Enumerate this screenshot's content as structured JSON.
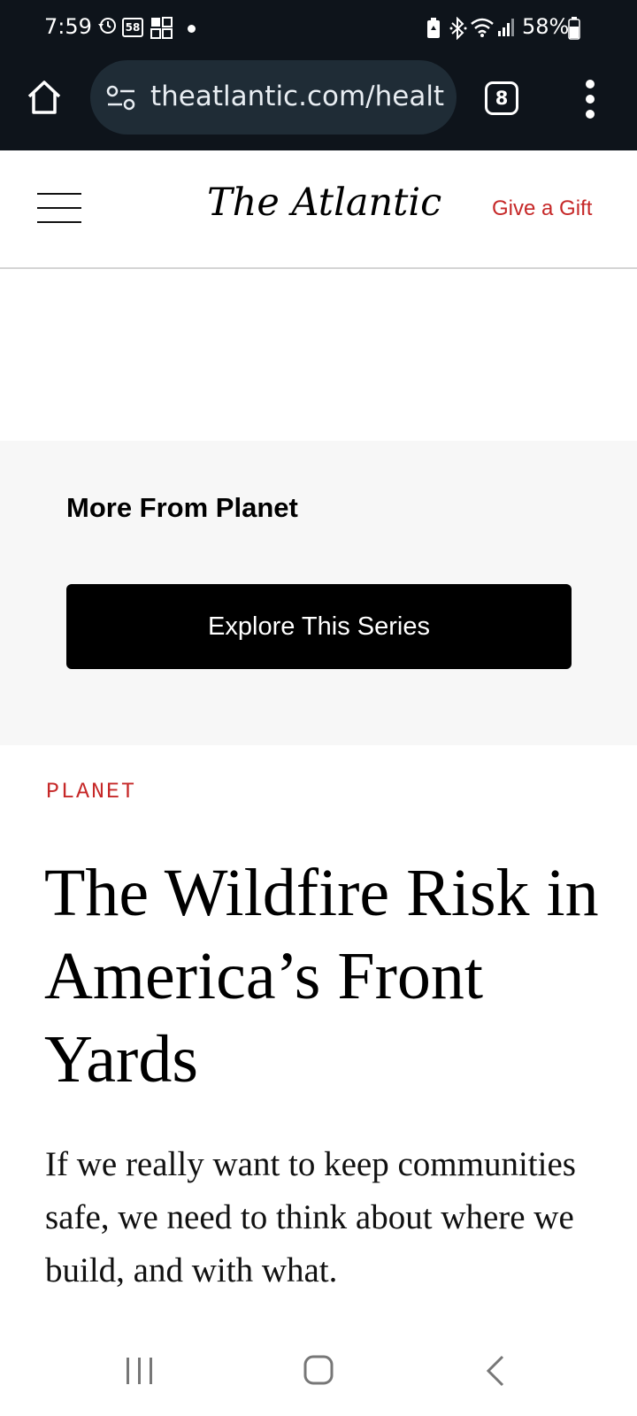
{
  "status_bar": {
    "time": "7:59",
    "badge": "58",
    "battery": "58%",
    "icons": [
      "history-icon",
      "notification-badge-icon",
      "grid-app-icon",
      "dot-icon",
      "battery-saver-icon",
      "bluetooth-icon",
      "wifi-icon",
      "signal-icon",
      "battery-icon"
    ]
  },
  "browser": {
    "url": "theatlantic.com/healt",
    "tab_count": "8",
    "icons": [
      "home-icon",
      "site-settings-icon",
      "tabs-icon",
      "more-menu-icon"
    ]
  },
  "header": {
    "logo": "The Atlantic",
    "gift_label": "Give a Gift",
    "icons": [
      "hamburger-menu-icon"
    ]
  },
  "promo": {
    "title": "More From Planet",
    "button_label": "Explore This Series"
  },
  "article": {
    "section": "PLANET",
    "headline": "The Wildfire Risk in America’s Front Yards",
    "dek": "If we really want to keep communities safe, we need to think about where we build, and with what."
  },
  "colors": {
    "accent_red": "#c62828",
    "chrome_dark": "#0e141b",
    "url_pill": "#1f2c36",
    "promo_bg": "#f7f7f7"
  },
  "nav_bar": {
    "icons": [
      "recents-icon",
      "home-nav-icon",
      "back-icon"
    ]
  }
}
